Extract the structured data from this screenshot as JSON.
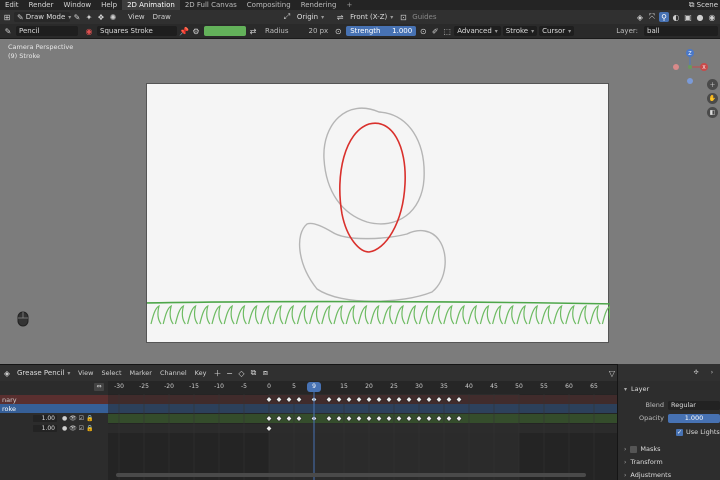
{
  "topbar": {
    "menus": [
      "Edit",
      "Render",
      "Window",
      "Help"
    ],
    "workspaces": [
      "2D Animation",
      "2D Full Canvas",
      "Compositing",
      "Rendering"
    ],
    "active_workspace": "2D Animation",
    "add_workspace": "+",
    "scene": "Scene"
  },
  "header": {
    "mode": "Draw Mode",
    "menus": [
      "View",
      "Draw"
    ],
    "origin": "Origin",
    "view_axis": "Front (X-Z)",
    "guides": "Guides"
  },
  "tool_settings": {
    "brush": "Pencil",
    "material": "Squares Stroke",
    "radius_label": "Radius",
    "radius_value": "20 px",
    "strength_label": "Strength",
    "strength_value": "1.000",
    "advanced": "Advanced",
    "stroke": "Stroke",
    "cursor": "Cursor",
    "layer_label": "Layer:",
    "layer_value": "ball"
  },
  "viewport": {
    "perspective": "Camera Perspective",
    "object": "(9) Stroke"
  },
  "dopesheet": {
    "mode": "Grease Pencil",
    "menus": [
      "View",
      "Select",
      "Marker",
      "Channel",
      "Key"
    ],
    "current_frame": "9",
    "ruler": [
      "-30",
      "-25",
      "-20",
      "-15",
      "-10",
      "-5",
      "0",
      "5",
      "15",
      "20",
      "25",
      "30",
      "35",
      "40",
      "45",
      "50",
      "55",
      "60",
      "65"
    ],
    "ruler_values": [
      -30,
      -25,
      -20,
      -15,
      -10,
      -5,
      0,
      5,
      15,
      20,
      25,
      30,
      35,
      40,
      45,
      50,
      55,
      60,
      65
    ],
    "channels": [
      {
        "name": "nary"
      },
      {
        "name": "roke"
      },
      {
        "name": "",
        "value": "1.00"
      },
      {
        "name": "",
        "value": "1.00"
      }
    ],
    "keyframes_row1": [
      0,
      2,
      4,
      6,
      9,
      12,
      14,
      16,
      18,
      20,
      22,
      24,
      26,
      28,
      30,
      32,
      34,
      36,
      38
    ],
    "keyframes_row2": [
      0,
      2,
      4,
      6,
      9,
      12,
      14,
      16,
      18,
      20,
      22,
      24,
      26,
      28,
      30,
      32,
      34,
      36,
      38
    ],
    "keyframes_row3": [
      0
    ]
  },
  "properties": {
    "section": "Layer",
    "blend_label": "Blend",
    "blend_value": "Regular",
    "opacity_label": "Opacity",
    "opacity_value": "1.000",
    "use_lights": "Use Lights",
    "masks": "Masks",
    "transform": "Transform",
    "adjustments": "Adjustments"
  },
  "colors": {
    "accent": "#4772b3",
    "stroke_green": "#63b15a",
    "stroke_red": "#d9302c",
    "stroke_gray": "#b5b5b5"
  }
}
